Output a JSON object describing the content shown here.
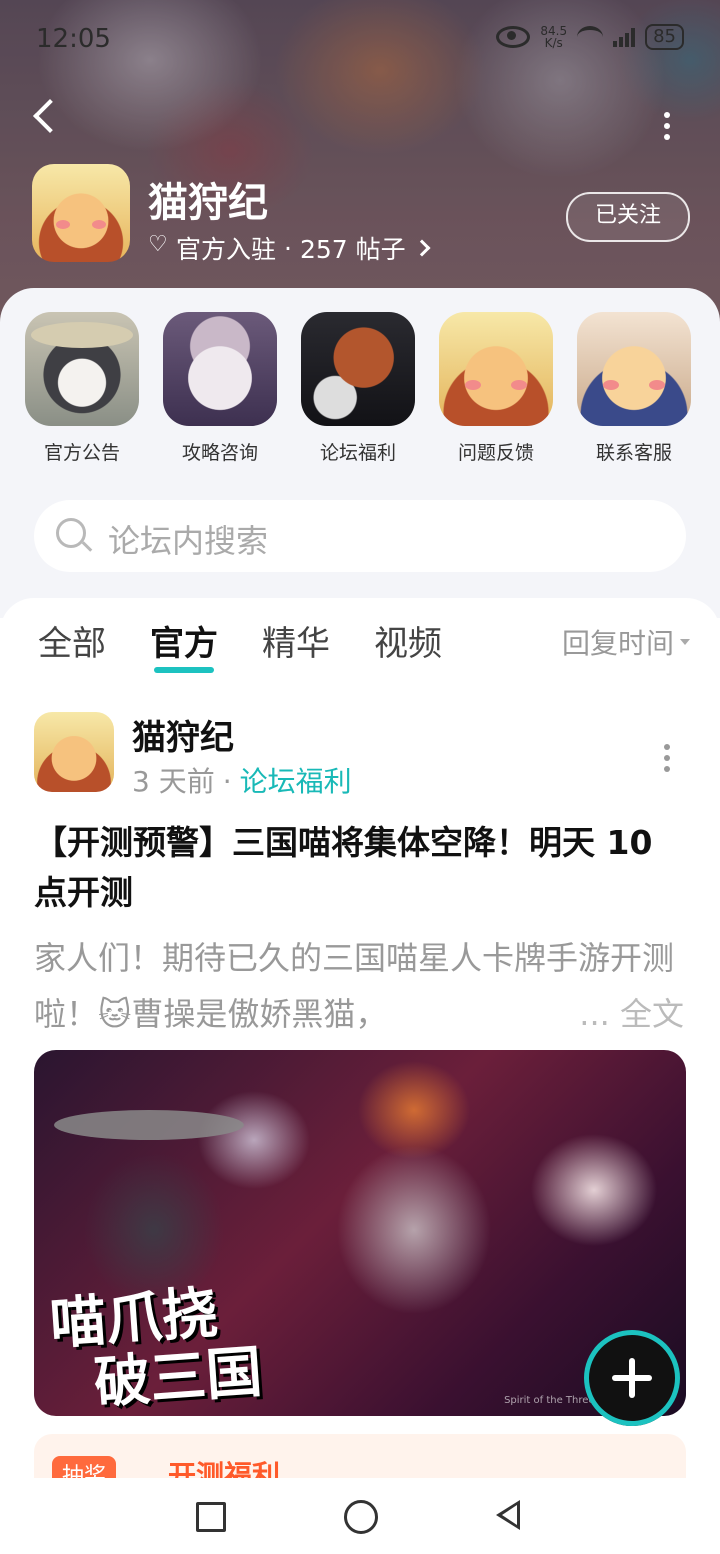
{
  "status_bar": {
    "time": "12:05",
    "net_speed_value": "84.5",
    "net_speed_unit": "K/s",
    "battery": "85"
  },
  "forum": {
    "name": "猫狩纪",
    "badge": "官方入驻",
    "separator": "·",
    "posts": "257 帖子",
    "follow_label": "已关注"
  },
  "categories": [
    {
      "label": "官方公告"
    },
    {
      "label": "攻略咨询"
    },
    {
      "label": "论坛福利"
    },
    {
      "label": "问题反馈"
    },
    {
      "label": "联系客服"
    }
  ],
  "search": {
    "placeholder": "论坛内搜索"
  },
  "tabs": [
    {
      "label": "全部"
    },
    {
      "label": "官方",
      "active": true
    },
    {
      "label": "精华"
    },
    {
      "label": "视频"
    }
  ],
  "sort": {
    "label": "回复时间"
  },
  "post": {
    "author": "猫狩纪",
    "time": "3 天前",
    "separator": "·",
    "tag": "论坛福利",
    "title": "【开测预警】三国喵将集体空降！明天 10 点开测",
    "body": "家人们！期待已久的三国喵星人卡牌手游开测啦！🐱曹操是傲娇黑猫，",
    "more_label": "... 全文",
    "banner_logo_line1": "喵爪挠",
    "banner_logo_line2": "破三国",
    "banner_caption": "Spirit of the Three Kingdoms For"
  },
  "promo": {
    "badge": "抽奖",
    "text": "开测福利"
  },
  "icons": {
    "accent": "#1cc2c0",
    "tag_color": "#19b9b7"
  }
}
